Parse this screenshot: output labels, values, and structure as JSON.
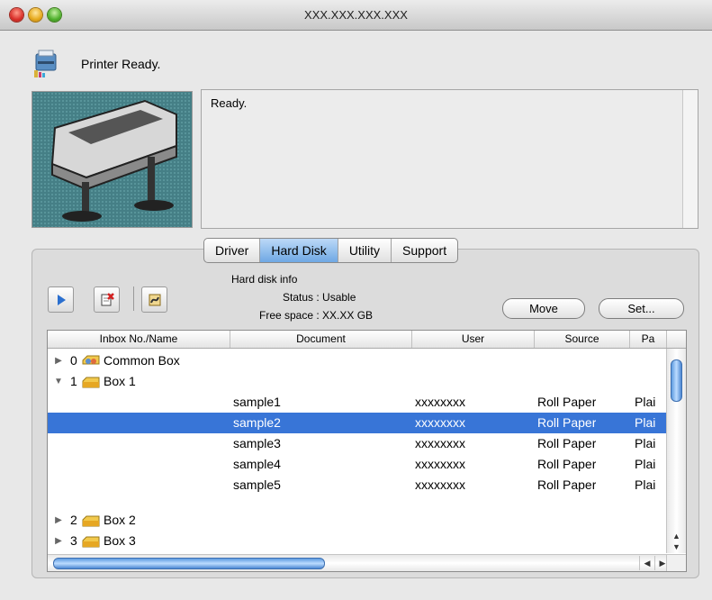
{
  "window": {
    "title": "XXX.XXX.XXX.XXX"
  },
  "status": {
    "text": "Printer Ready.",
    "message": "Ready."
  },
  "tabs": [
    {
      "label": "Driver"
    },
    {
      "label": "Hard Disk",
      "selected": true
    },
    {
      "label": "Utility"
    },
    {
      "label": "Support"
    }
  ],
  "toolbar": {
    "play_icon": "play-icon",
    "delete_icon": "delete-document-icon",
    "log_icon": "job-log-icon"
  },
  "hdinfo": {
    "title": "Hard disk info",
    "status": "Status : Usable",
    "free_space": "Free space : XX.XX GB"
  },
  "buttons": {
    "move": "Move",
    "set": "Set..."
  },
  "table": {
    "columns": [
      "Inbox No./Name",
      "Document",
      "User",
      "Source",
      "Pa"
    ],
    "boxes": [
      {
        "num": "0",
        "name": "Common Box",
        "expanded": false
      },
      {
        "num": "1",
        "name": "Box 1",
        "expanded": true
      },
      {
        "num": "2",
        "name": "Box 2",
        "expanded": false
      },
      {
        "num": "3",
        "name": "Box 3",
        "expanded": false
      }
    ],
    "documents": [
      {
        "doc": "sample1",
        "user": "xxxxxxxx",
        "source": "Roll Paper",
        "paper": "Plai"
      },
      {
        "doc": "sample2",
        "user": "xxxxxxxx",
        "source": "Roll Paper",
        "paper": "Plai",
        "selected": true
      },
      {
        "doc": "sample3",
        "user": "xxxxxxxx",
        "source": "Roll Paper",
        "paper": "Plai"
      },
      {
        "doc": "sample4",
        "user": "xxxxxxxx",
        "source": "Roll Paper",
        "paper": "Plai"
      },
      {
        "doc": "sample5",
        "user": "xxxxxxxx",
        "source": "Roll Paper",
        "paper": "Plai"
      }
    ]
  },
  "colors": {
    "selection": "#3875d7",
    "tab_selected": "#6fa8e4"
  }
}
